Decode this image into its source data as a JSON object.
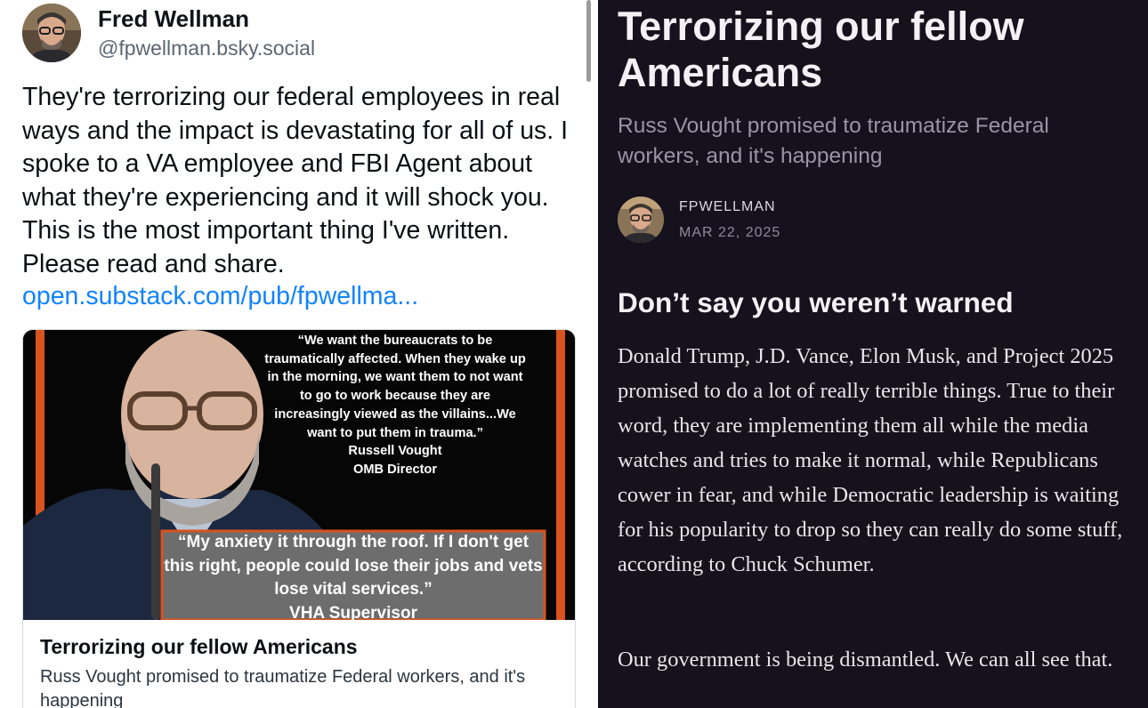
{
  "post": {
    "author_name": "Fred Wellman",
    "author_handle": "@fpwellman.bsky.social",
    "text": "They're terrorizing our federal employees in real ways and the impact is devastating for all of us. I spoke to a VA employee and FBI Agent about what they're experiencing and it will shock you. This is the most important thing I've written. Please read and share.",
    "link_text": "open.substack.com/pub/fpwellma...",
    "card": {
      "title": "Terrorizing our fellow Americans",
      "description": "Russ Vought promised to traumatize Federal workers, and it's happening",
      "image_quote_1": "“We want the bureaucrats to be traumatically affected. When they wake up in the morning, we want them to not want to go to work because they are increasingly viewed as the villains...We want to put them in trauma.”",
      "image_quote_1_author": "Russell Vought",
      "image_quote_1_role": "OMB Director",
      "image_quote_2": "“My anxiety it through the roof. If I don't get this right, people could lose their jobs and vets lose vital services.”",
      "image_quote_2_author": "VHA Supervisor"
    }
  },
  "article": {
    "title": "Terrorizing our fellow Americans",
    "subtitle": "Russ Vought promised to traumatize Federal workers, and it's happening",
    "author": "FPWELLMAN",
    "date": "MAR 22, 2025",
    "heading": "Don’t say you weren’t warned",
    "paragraph_1": "Donald Trump, J.D. Vance, Elon Musk, and Project 2025 promised to do a lot of really terrible things. True to their word, they are implementing them all while the media watches and tries to make it normal, while Republicans cower in fear, and while Democratic leadership is waiting for his popularity to drop so they can really do some stuff, according to Chuck Schumer.",
    "paragraph_2": "Our government is being dismantled. We can all see that."
  },
  "colors": {
    "link": "#1083fe",
    "article_background": "#15111d",
    "image_accent": "#d9531e"
  }
}
